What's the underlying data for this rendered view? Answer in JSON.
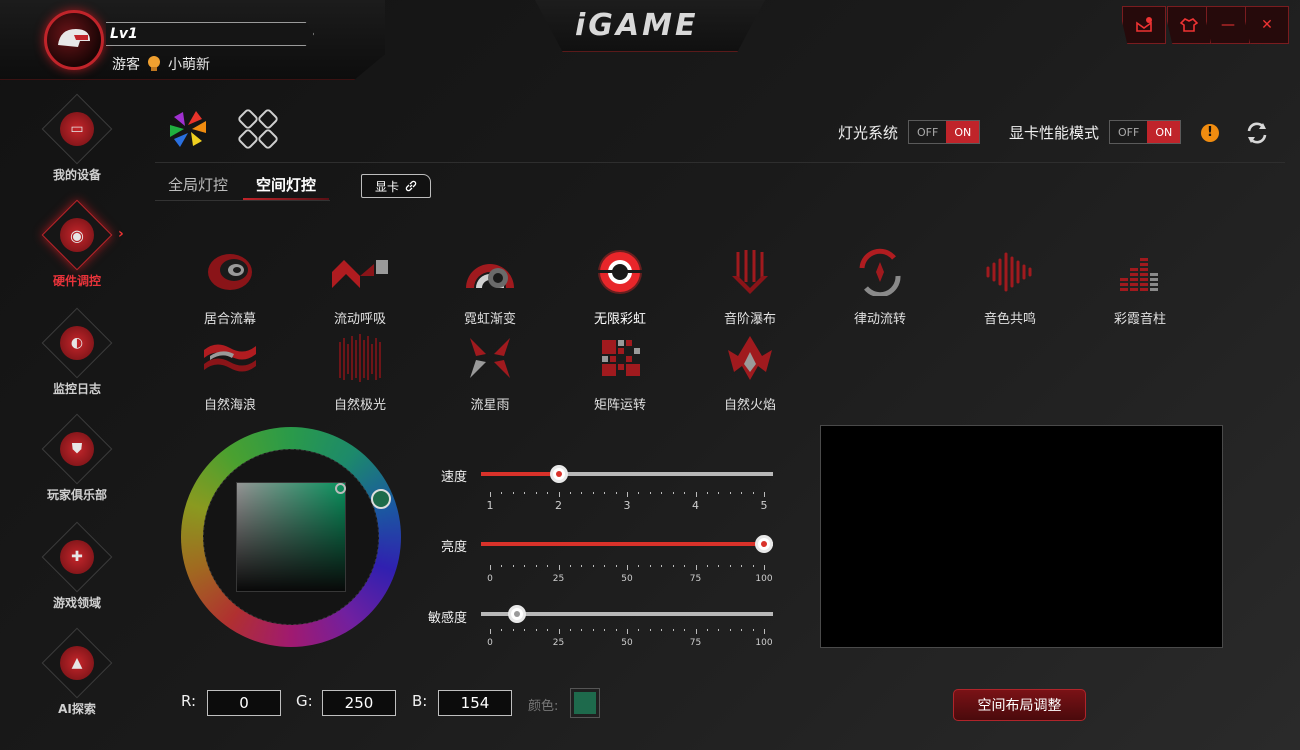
{
  "header": {
    "level": "Lv1",
    "user_type": "游客",
    "username": "小萌新",
    "logo": "iGAME"
  },
  "window_controls": [
    "message-icon",
    "skin-icon",
    "minimize-icon",
    "close-icon"
  ],
  "sidebar": {
    "items": [
      {
        "label": "我的设备",
        "icon": "monitor-icon",
        "active": false
      },
      {
        "label": "硬件调控",
        "icon": "dial-icon",
        "active": true
      },
      {
        "label": "监控日志",
        "icon": "monitor-log-icon",
        "active": false
      },
      {
        "label": "玩家俱乐部",
        "icon": "club-icon",
        "active": false
      },
      {
        "label": "游戏领域",
        "icon": "gamepad-icon",
        "active": false
      },
      {
        "label": "AI探索",
        "icon": "ai-icon",
        "active": false
      }
    ]
  },
  "toggles": {
    "light_system": {
      "label": "灯光系统",
      "off": "OFF",
      "on": "ON"
    },
    "gpu_mode": {
      "label": "显卡性能模式",
      "off": "OFF",
      "on": "ON"
    },
    "warning": "!"
  },
  "tabs": {
    "global": "全局灯控",
    "space": "空间灯控",
    "gpu_button": "显卡"
  },
  "effects": [
    {
      "label": "居合流幕",
      "icon": "swirl-effect-icon"
    },
    {
      "label": "流动呼吸",
      "icon": "wave-block-effect-icon"
    },
    {
      "label": "霓虹渐变",
      "icon": "neon-effect-icon"
    },
    {
      "label": "无限彩虹",
      "icon": "rainbow-ring-effect-icon",
      "selected": true
    },
    {
      "label": "音阶瀑布",
      "icon": "waterfall-effect-icon"
    },
    {
      "label": "律动流转",
      "icon": "rotate-effect-icon"
    },
    {
      "label": "音色共鸣",
      "icon": "soundwave-effect-icon"
    },
    {
      "label": "彩霞音柱",
      "icon": "equalizer-effect-icon"
    },
    {
      "label": "自然海浪",
      "icon": "ocean-wave-effect-icon"
    },
    {
      "label": "自然极光",
      "icon": "aurora-effect-icon"
    },
    {
      "label": "流星雨",
      "icon": "meteor-effect-icon"
    },
    {
      "label": "矩阵运转",
      "icon": "matrix-effect-icon"
    },
    {
      "label": "自然火焰",
      "icon": "flame-effect-icon"
    }
  ],
  "sliders": {
    "speed": {
      "label": "速度",
      "value": 2,
      "min": 1,
      "max": 5,
      "ticks": [
        "1",
        "2",
        "3",
        "4",
        "5"
      ]
    },
    "brightness": {
      "label": "亮度",
      "value": 100,
      "min": 0,
      "max": 100,
      "ticks": [
        "0",
        "25",
        "50",
        "75",
        "100"
      ]
    },
    "sensitivity": {
      "label": "敏感度",
      "value": 10,
      "min": 0,
      "max": 100,
      "ticks": [
        "0",
        "25",
        "50",
        "75",
        "100"
      ]
    }
  },
  "rgb": {
    "r_label": "R:",
    "r": "0",
    "g_label": "G:",
    "g": "250",
    "b_label": "B:",
    "b": "154",
    "color_label": "颜色:",
    "swatch_color": "#1e6a4c"
  },
  "layout_button": "空间布局调整",
  "colors": {
    "accent": "#c0242a",
    "warning": "#f08c10"
  }
}
